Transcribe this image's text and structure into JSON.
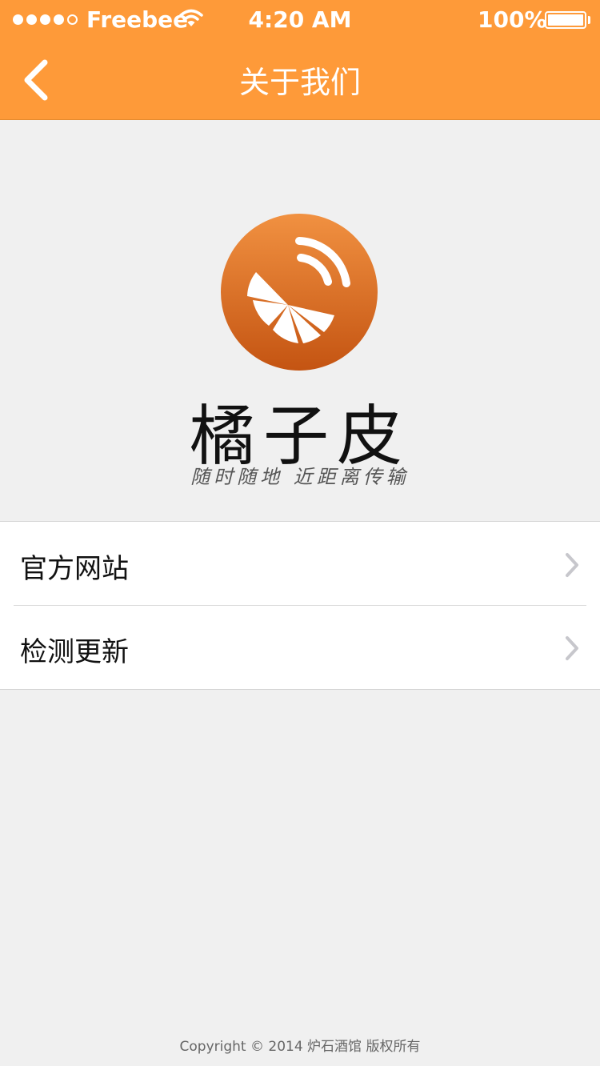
{
  "status_bar": {
    "carrier": "Freebee",
    "time": "4:20 AM",
    "battery": "100%",
    "signal_bars_filled": 4,
    "signal_bars_total": 5,
    "battery_level": 1.0,
    "wifi_icon": "wifi-icon"
  },
  "nav": {
    "title": "关于我们",
    "back_icon": "chevron-left-icon"
  },
  "brand": {
    "logo_icon": "orange-slice-signal-logo",
    "name": "橘子皮",
    "slogan": "随时随地 近距离传输"
  },
  "menu": {
    "items": [
      {
        "label": "官方网站",
        "icon": "chevron-right-icon"
      },
      {
        "label": "检测更新",
        "icon": "chevron-right-icon"
      }
    ]
  },
  "footer": {
    "copyright": "Copyright © 2014 炉石酒馆 版权所有"
  },
  "colors": {
    "accent": "#fe9a39",
    "logo_top": "#f19141",
    "logo_bottom": "#c45412",
    "background": "#f0f0f0"
  }
}
